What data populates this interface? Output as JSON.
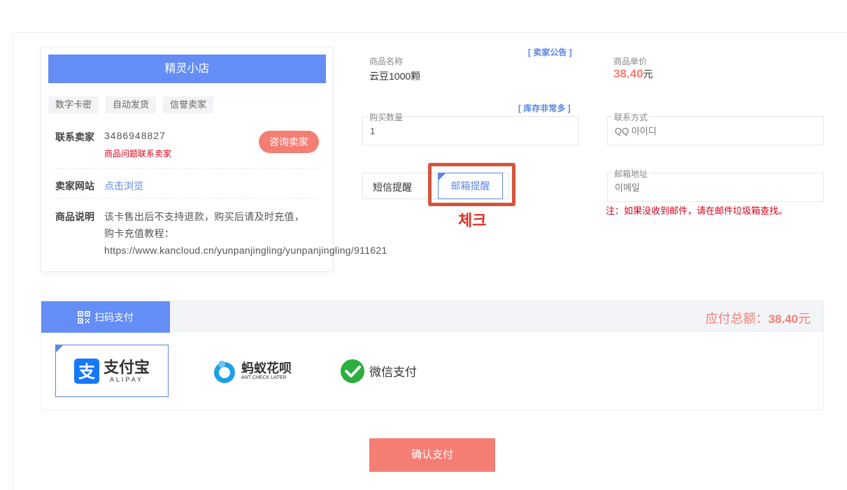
{
  "seller": {
    "shop_name": "精灵小店",
    "tags": [
      "数字卡密",
      "自动发货",
      "信誉卖家"
    ],
    "contact_label": "联系卖家",
    "contact_value": "3486948827",
    "contact_note": "商品问题联系卖家",
    "consult_button": "咨询卖家",
    "site_label": "卖家网站",
    "site_link": "点击浏览",
    "desc_label": "商品说明",
    "desc_line1": "该卡售出后不支持退款，购买后请及时充值，",
    "desc_line2": "购卡充值教程：",
    "desc_line3": "https://www.kancloud.cn/yunpanjingling/yunpanjingling/911621"
  },
  "product": {
    "name_label": "商品名称",
    "name_value": "云豆1000颗",
    "notice_link": "[ 卖家公告 ]",
    "price_label": "商品单价",
    "price_value": "38.40",
    "price_unit": "元"
  },
  "form": {
    "qty_label": "购买数量",
    "stock_link": "[ 库存非常多 ]",
    "qty_value": "1",
    "contact_label": "联系方式",
    "contact_placeholder": "QQ 아이디",
    "sms_label": "短信提醒",
    "email_label": "邮箱提醒",
    "email_field_label": "邮箱地址",
    "email_placeholder": "이메일",
    "email_note": "注：如果没收到邮件，请在邮件垃圾箱查找。"
  },
  "annotation": {
    "check_text": "체크",
    "color": "#d4553b"
  },
  "payment": {
    "tab_label": "扫码支付",
    "total_label": "应付总额：",
    "total_value": "38.40",
    "total_unit": "元",
    "options": [
      {
        "name": "支付宝",
        "sub": "ALIPAY",
        "icon": "alipay-icon"
      },
      {
        "name": "蚂蚁花呗",
        "sub": "ANT CHECK LATER",
        "icon": "huabei-icon"
      },
      {
        "name": "微信支付",
        "icon": "wechat-icon"
      }
    ],
    "confirm_button": "确认支付"
  },
  "colors": {
    "primary": "#648ef5",
    "accent": "#f47e74",
    "link": "#5b86e5",
    "warn": "#d9001b"
  }
}
